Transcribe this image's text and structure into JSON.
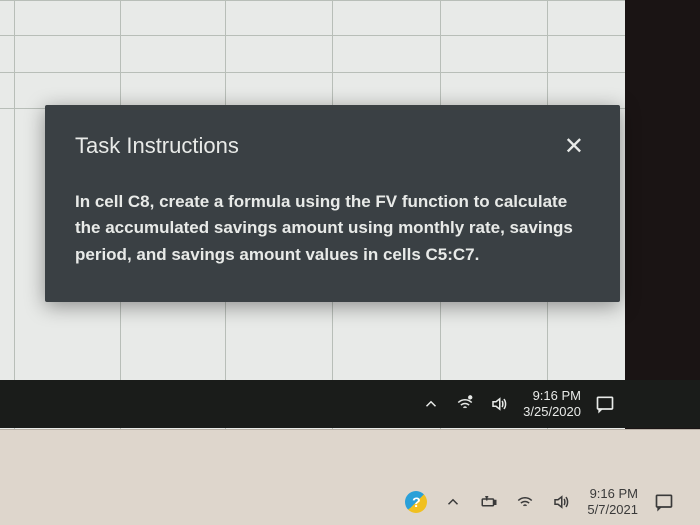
{
  "modal": {
    "title": "Task Instructions",
    "body": "In cell C8, create a formula using the FV function to calculate the accumulated savings amount using monthly rate, savings period, and savings amount values in cells C5:C7.",
    "closeLabel": "✕"
  },
  "taskbarInner": {
    "time": "9:16 PM",
    "date": "3/25/2020"
  },
  "taskbarOuter": {
    "time": "9:16 PM",
    "date": "5/7/2021",
    "helpGlyph": "?"
  },
  "colors": {
    "modalBg": "#3a4044",
    "spreadsheetBg": "#e8eae8",
    "outerTaskbar": "#ded6cc",
    "innerTaskbar": "#1a1c1a"
  }
}
